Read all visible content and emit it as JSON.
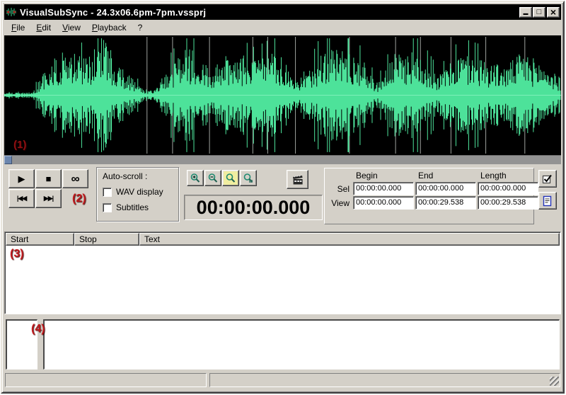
{
  "window": {
    "title": "VisualSubSync - 24.3x06.6pm-7pm.vssprj",
    "controls": {
      "minimize": "▬",
      "maximize": "□",
      "close": "×"
    }
  },
  "menu": {
    "items": [
      {
        "label": "File"
      },
      {
        "label": "Edit"
      },
      {
        "label": "View"
      },
      {
        "label": "Playback"
      },
      {
        "label": "?"
      }
    ]
  },
  "annotations": {
    "n1": "(1)",
    "n2": "(2)",
    "n3": "(3)",
    "n4": "(4)"
  },
  "waveform": {
    "color": "#4de29a",
    "background": "#000000",
    "centerline": "#7defb8"
  },
  "transport": {
    "play": "▶",
    "stop": "■",
    "loop": "∞",
    "skip_back": "|◀◀",
    "skip_forward": "▶▶|"
  },
  "autoscroll": {
    "label": "Auto-scroll :",
    "options": [
      {
        "label": "WAV display",
        "checked": false
      },
      {
        "label": "Subtitles",
        "checked": false
      }
    ]
  },
  "time_display": {
    "value": "00:00:00.000"
  },
  "selection_panel": {
    "headers": [
      "Begin",
      "End",
      "Length"
    ],
    "rows": [
      {
        "label": "Sel",
        "values": [
          "00:00:00.000",
          "00:00:00.000",
          "00:00:00.000"
        ]
      },
      {
        "label": "View",
        "values": [
          "00:00:00.000",
          "00:00:29.538",
          "00:00:29.538"
        ]
      }
    ]
  },
  "subtitle_list": {
    "columns": [
      "Start",
      "Stop",
      "Text"
    ],
    "rows": []
  },
  "status_bar": {
    "left": "",
    "right": ""
  },
  "icons": {
    "zoom_in_sign": "+",
    "zoom_out_sign": "−"
  }
}
